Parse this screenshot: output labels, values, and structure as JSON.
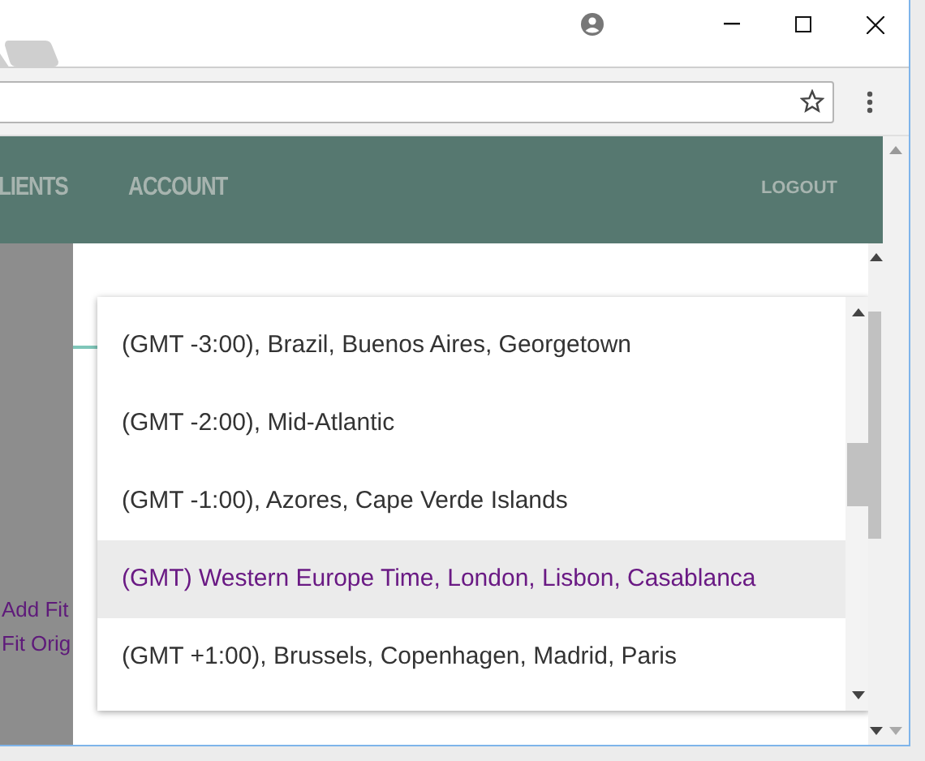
{
  "navbar": {
    "items": [
      {
        "label": "LIENTS"
      },
      {
        "label": "ACCOUNT"
      }
    ],
    "logout": "LOGOUT"
  },
  "background_links": [
    "Add Fit",
    "Fit Orig"
  ],
  "timezone_list": {
    "options": [
      {
        "label": "(GMT -3:00), Brazil, Buenos Aires, Georgetown",
        "selected": false
      },
      {
        "label": "(GMT -2:00), Mid-Atlantic",
        "selected": false
      },
      {
        "label": "(GMT -1:00), Azores, Cape Verde Islands",
        "selected": false
      },
      {
        "label": "(GMT) Western Europe Time, London, Lisbon, Casablanca",
        "selected": true
      },
      {
        "label": "(GMT +1:00), Brussels, Copenhagen, Madrid, Paris",
        "selected": false
      }
    ]
  }
}
